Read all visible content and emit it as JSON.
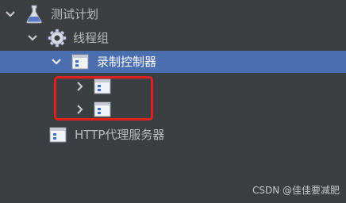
{
  "tree": {
    "test_plan": {
      "label": "测试计划",
      "icon": "flask-icon",
      "expanded": true
    },
    "thread_group": {
      "label": "线程组",
      "icon": "gear-icon",
      "expanded": true
    },
    "recording_controller": {
      "label": "录制控制器",
      "icon": "controller-icon",
      "expanded": true,
      "selected": true
    },
    "child_1": {
      "label": "",
      "icon": "controller-icon",
      "expanded": false
    },
    "child_2": {
      "label": "",
      "icon": "controller-icon",
      "expanded": false
    },
    "http_proxy": {
      "label": "HTTP代理服务器",
      "icon": "controller-icon"
    }
  },
  "highlight": {
    "color": "#e02020"
  },
  "watermark": "CSDN @佳佳要减肥",
  "colors": {
    "background": "#3c3f41",
    "selection": "#4b6eaf"
  }
}
